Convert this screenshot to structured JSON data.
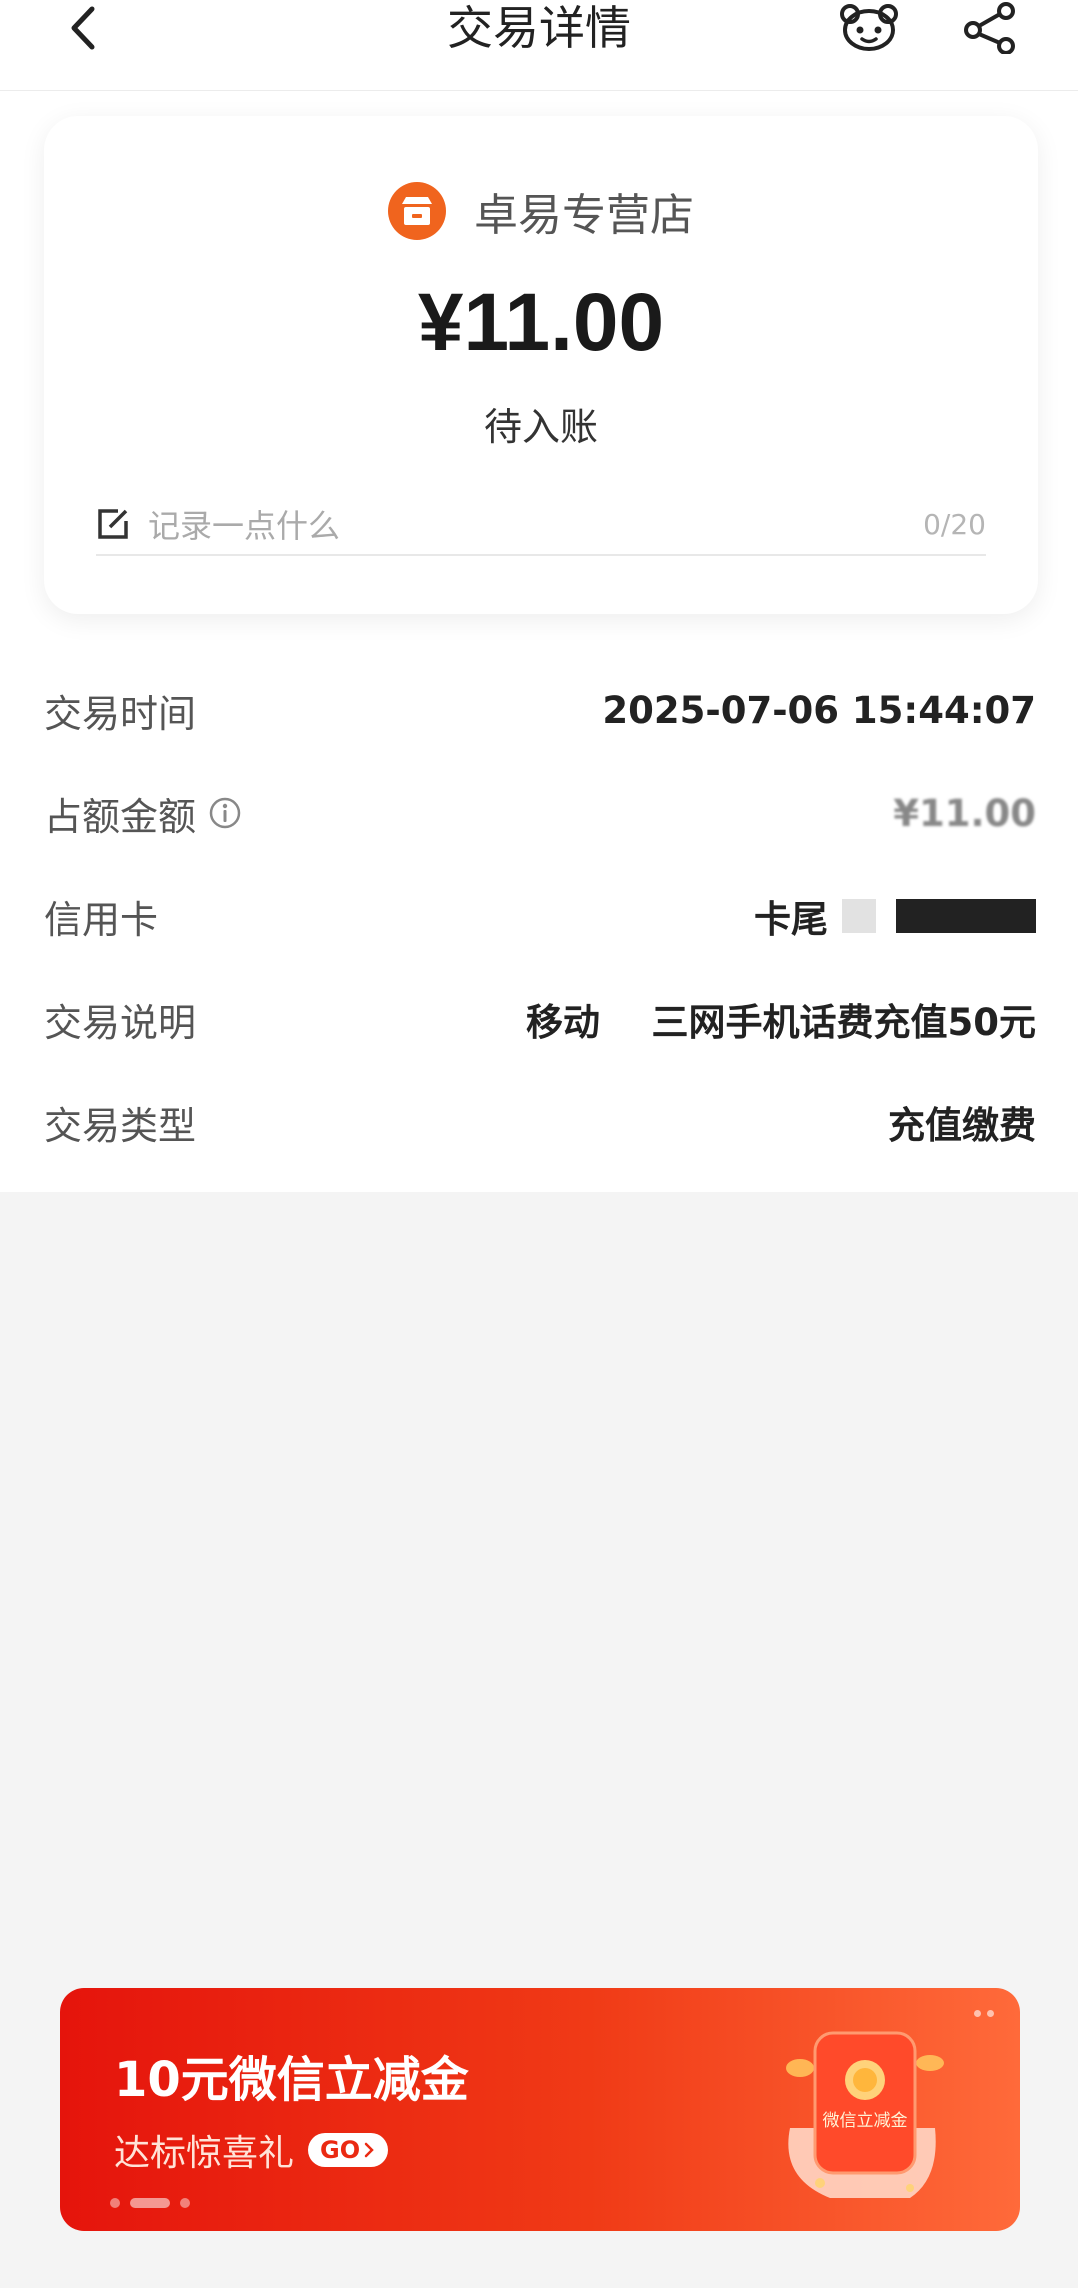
{
  "header": {
    "title": "交易详情"
  },
  "shop": {
    "name": "卓易专营店"
  },
  "transaction": {
    "amount": "¥11.00",
    "status": "待入账",
    "memo_placeholder": "记录一点什么",
    "memo_count": "0/20"
  },
  "details": [
    {
      "label": "交易时间",
      "value": "2025-07-06 15:44:07"
    },
    {
      "label": "占额金额",
      "value": "¥11.00"
    },
    {
      "label": "信用卡",
      "value": "卡尾"
    },
    {
      "label": "交易说明",
      "value": "移动    三网手机话费充值50元"
    },
    {
      "label": "交易类型",
      "value": "充值缴费"
    }
  ],
  "banner": {
    "title": "10元微信立减金",
    "subtitle": "达标惊喜礼",
    "go_label": "GO",
    "card_label": "微信立减金"
  },
  "colors": {
    "brand_orange": "#f0641e",
    "banner_red": "#e5140c"
  },
  "icons": [
    "back-arrow-icon",
    "customer-service-icon",
    "share-icon",
    "store-icon",
    "edit-icon",
    "info-icon"
  ]
}
